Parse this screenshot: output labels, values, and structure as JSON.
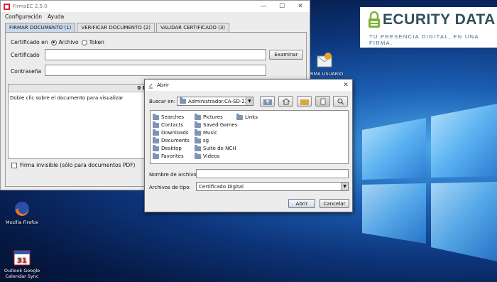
{
  "colors": {
    "accent": "#c9d8ea",
    "brand": "#2f4f5e",
    "desktop": "#0d3479"
  },
  "brand": {
    "name": "ECURITY DATA",
    "tagline": "TU PRESENCIA DIGITAL, EN UNA FIRMA."
  },
  "desktop": {
    "icons": [
      {
        "label": "Mozilla Firefox",
        "icon": "firefox-icon"
      },
      {
        "label": "Outlook Google Calendar Sync",
        "icon": "calendar-sync-icon"
      }
    ],
    "partial_label": "RMA USUARIO"
  },
  "app": {
    "title": "FirmaEC 2.5.0",
    "menu": [
      "Configuración",
      "Ayuda"
    ],
    "tabs": [
      "FIRMAR DOCUMENTO (1)",
      "VERIFICAR DOCUMENTO (2)",
      "VALIDAR CERTIFICADO (3)"
    ],
    "cert_in_label": "Certificado en",
    "radio_file": "Archivo",
    "radio_token": "Token",
    "certificate_label": "Certificado",
    "certificate_value": "",
    "browse_button": "Examinar",
    "password_label": "Contraseña",
    "password_value": "",
    "documents_header": "0 DOCUMENT",
    "documents_hint": "Doble clic sobre el documento para visualizar",
    "invisible_sig": "Firma invisible (sólo para documentos PDF)"
  },
  "dialog": {
    "title": "Abrir",
    "look_in_label": "Buscar en:",
    "look_in_value": "Administrador.CA-SD-22",
    "files": [
      [
        "Searches",
        "Contacts",
        "Downloads",
        "Documents",
        "Desktop",
        "Favorites"
      ],
      [
        "Pictures",
        "Saved Games",
        "Music",
        "sg",
        "Suite de NCH",
        "Videos"
      ],
      [
        "Links"
      ]
    ],
    "filename_label": "Nombre de archivo:",
    "filename_value": "",
    "filetype_label": "Archivos de tipo:",
    "filetype_value": "Certificado Digital",
    "open_button": "Abrir",
    "cancel_button": "Cancelar"
  }
}
